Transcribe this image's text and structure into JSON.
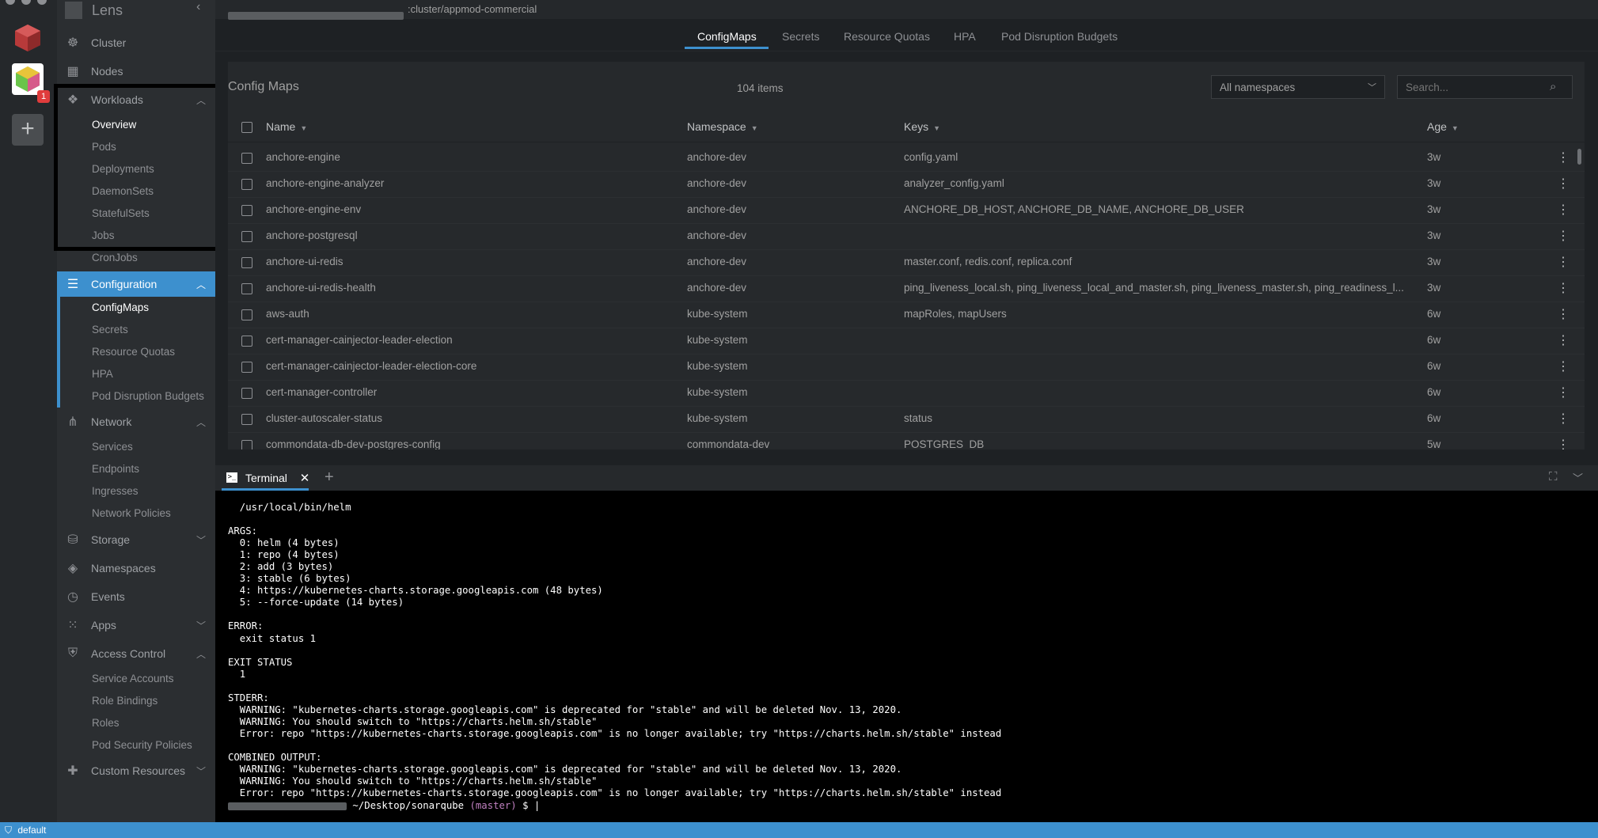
{
  "app": {
    "name": "Lens",
    "cluster_path": ":cluster/appmod-commercial",
    "dock_badge": "1"
  },
  "sidebar": {
    "cluster": "Cluster",
    "nodes": "Nodes",
    "workloads": "Workloads",
    "workload_items": [
      "Overview",
      "Pods",
      "Deployments",
      "DaemonSets",
      "StatefulSets",
      "Jobs",
      "CronJobs"
    ],
    "configuration": "Configuration",
    "configuration_items": [
      "ConfigMaps",
      "Secrets",
      "Resource Quotas",
      "HPA",
      "Pod Disruption Budgets"
    ],
    "network": "Network",
    "network_items": [
      "Services",
      "Endpoints",
      "Ingresses",
      "Network Policies"
    ],
    "storage": "Storage",
    "namespaces": "Namespaces",
    "events": "Events",
    "apps": "Apps",
    "access_control": "Access Control",
    "access_items": [
      "Service Accounts",
      "Role Bindings",
      "Roles",
      "Pod Security Policies"
    ],
    "custom_resources": "Custom Resources"
  },
  "tabs": [
    "ConfigMaps",
    "Secrets",
    "Resource Quotas",
    "HPA",
    "Pod Disruption Budgets"
  ],
  "list": {
    "title": "Config Maps",
    "count": "104 items",
    "namespace_select": "All namespaces",
    "search_placeholder": "Search...",
    "columns": [
      "Name",
      "Namespace",
      "Keys",
      "Age"
    ],
    "rows": [
      [
        "anchore-engine",
        "anchore-dev",
        "config.yaml",
        "3w"
      ],
      [
        "anchore-engine-analyzer",
        "anchore-dev",
        "analyzer_config.yaml",
        "3w"
      ],
      [
        "anchore-engine-env",
        "anchore-dev",
        "ANCHORE_DB_HOST, ANCHORE_DB_NAME, ANCHORE_DB_USER",
        "3w"
      ],
      [
        "anchore-postgresql",
        "anchore-dev",
        "",
        "3w"
      ],
      [
        "anchore-ui-redis",
        "anchore-dev",
        "master.conf, redis.conf, replica.conf",
        "3w"
      ],
      [
        "anchore-ui-redis-health",
        "anchore-dev",
        "ping_liveness_local.sh, ping_liveness_local_and_master.sh, ping_liveness_master.sh, ping_readiness_l...",
        "3w"
      ],
      [
        "aws-auth",
        "kube-system",
        "mapRoles, mapUsers",
        "6w"
      ],
      [
        "cert-manager-cainjector-leader-election",
        "kube-system",
        "",
        "6w"
      ],
      [
        "cert-manager-cainjector-leader-election-core",
        "kube-system",
        "",
        "6w"
      ],
      [
        "cert-manager-controller",
        "kube-system",
        "",
        "6w"
      ],
      [
        "cluster-autoscaler-status",
        "kube-system",
        "status",
        "6w"
      ],
      [
        "commondata-db-dev-postgres-config",
        "commondata-dev",
        "POSTGRES_DB",
        "5w"
      ]
    ]
  },
  "terminal": {
    "tab_label": "Terminal",
    "output": "  /usr/local/bin/helm\n\nARGS:\n  0: helm (4 bytes)\n  1: repo (4 bytes)\n  2: add (3 bytes)\n  3: stable (6 bytes)\n  4: https://kubernetes-charts.storage.googleapis.com (48 bytes)\n  5: --force-update (14 bytes)\n\nERROR:\n  exit status 1\n\nEXIT STATUS\n  1\n\nSTDERR:\n  WARNING: \"kubernetes-charts.storage.googleapis.com\" is deprecated for \"stable\" and will be deleted Nov. 13, 2020.\n  WARNING: You should switch to \"https://charts.helm.sh/stable\"\n  Error: repo \"https://kubernetes-charts.storage.googleapis.com\" is no longer available; try \"https://charts.helm.sh/stable\" instead\n\nCOMBINED OUTPUT:\n  WARNING: \"kubernetes-charts.storage.googleapis.com\" is deprecated for \"stable\" and will be deleted Nov. 13, 2020.\n  WARNING: You should switch to \"https://charts.helm.sh/stable\"\n  Error: repo \"https://kubernetes-charts.storage.googleapis.com\" is no longer available; try \"https://charts.helm.sh/stable\" instead",
    "prompt_path": "~/Desktop/sonarqube",
    "prompt_branch": "(master)",
    "prompt_symbol": "$ |"
  },
  "status": {
    "context": "default"
  },
  "colors": {
    "accent": "#3d90ce",
    "sidebar": "#2b2e31",
    "panel": "#26292c"
  }
}
